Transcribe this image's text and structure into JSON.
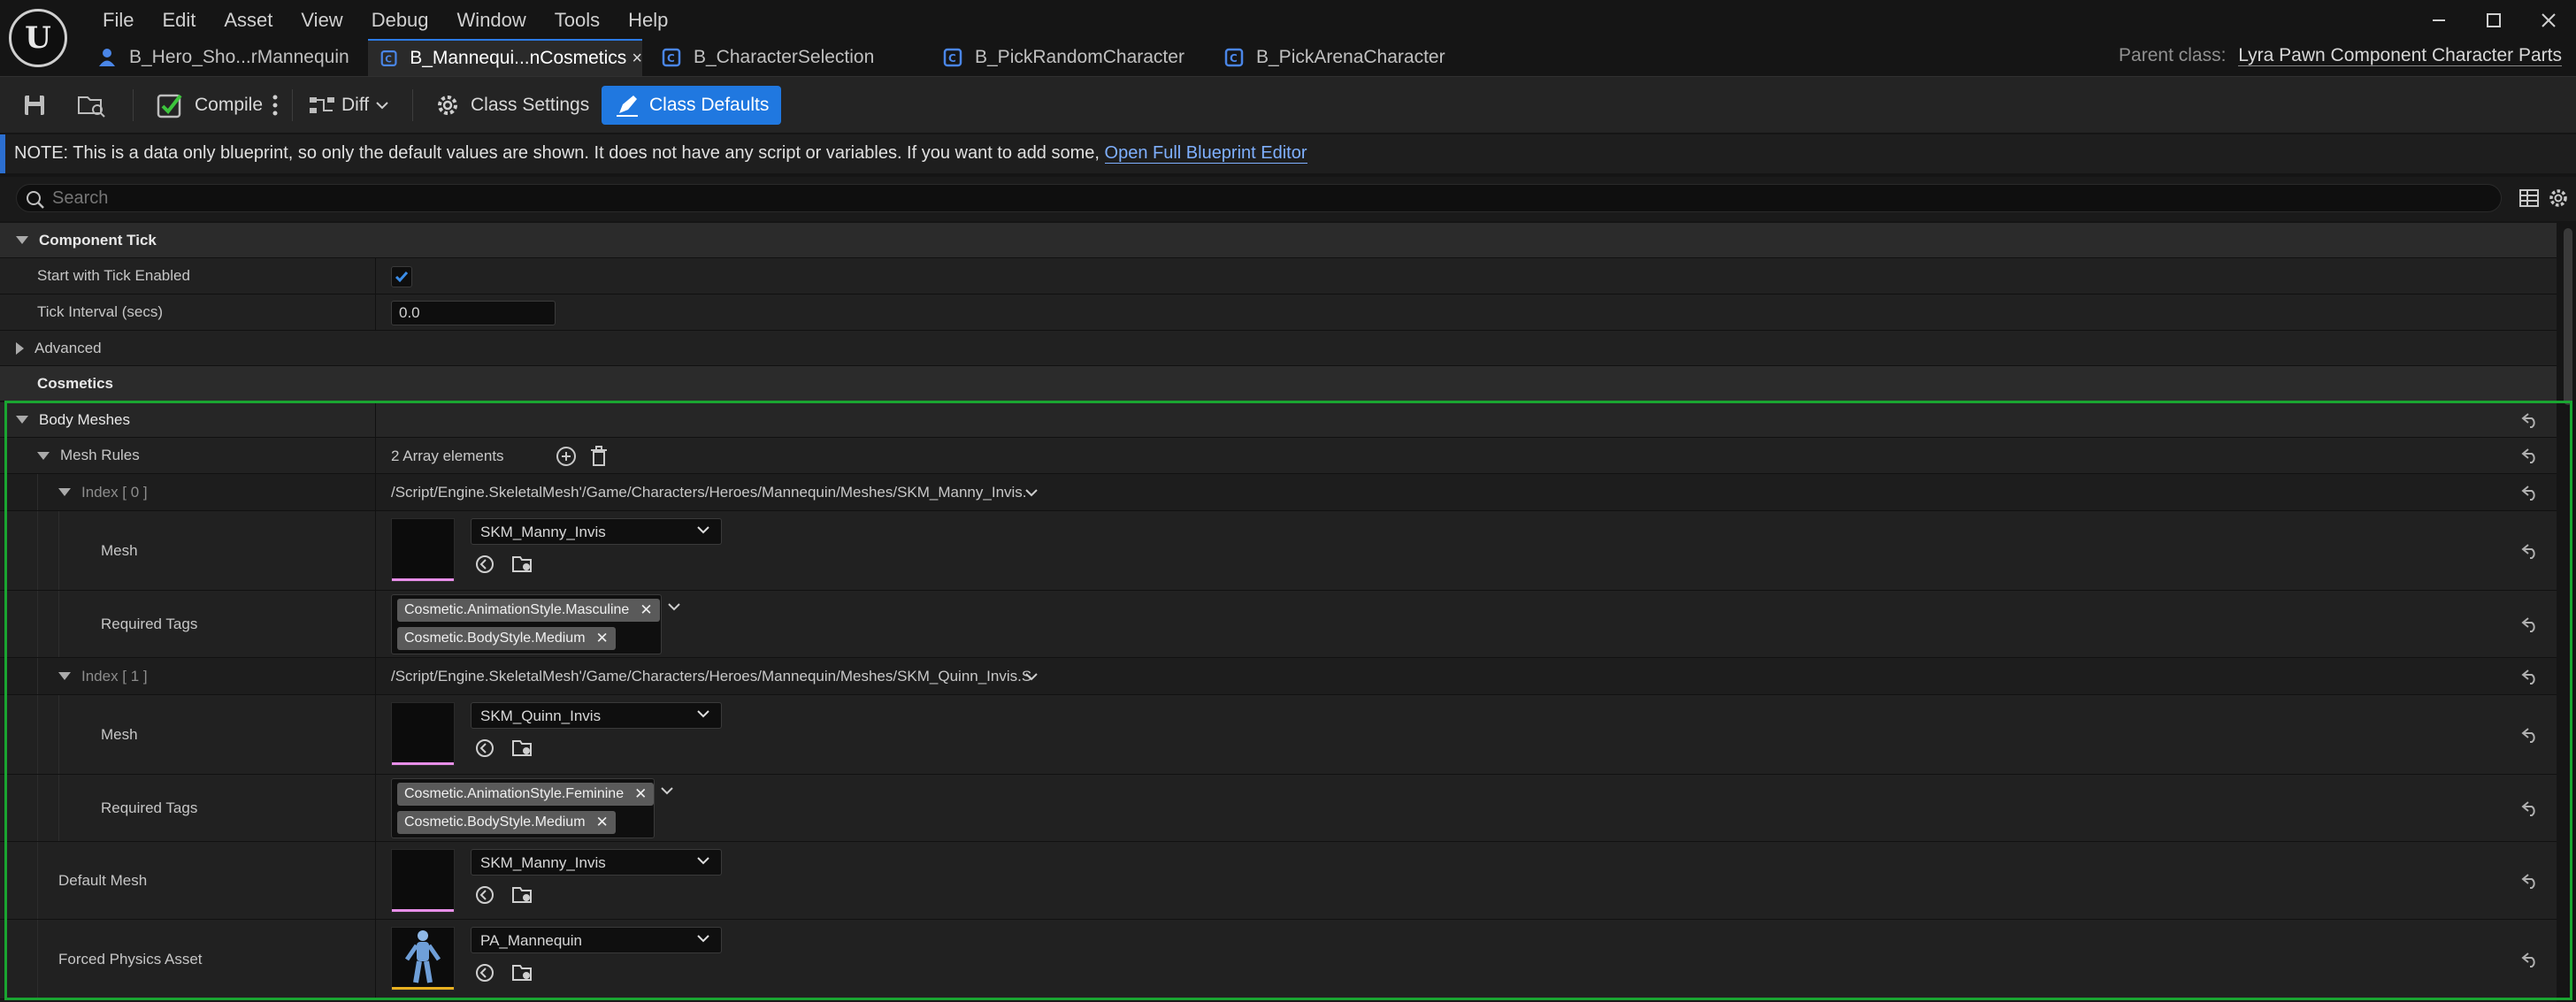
{
  "app": {
    "logo_letter": "U"
  },
  "menu": [
    "File",
    "Edit",
    "Asset",
    "View",
    "Debug",
    "Window",
    "Tools",
    "Help"
  ],
  "tabs": [
    {
      "label": "B_Hero_Sho...rMannequin",
      "icon": "pawn-icon"
    },
    {
      "label": "B_Mannequi...nCosmetics",
      "icon": "blueprint-icon",
      "active": true
    },
    {
      "label": "B_CharacterSelection",
      "icon": "blueprint-icon"
    },
    {
      "label": "B_PickRandomCharacter",
      "icon": "blueprint-icon"
    },
    {
      "label": "B_PickArenaCharacter",
      "icon": "blueprint-icon"
    }
  ],
  "parent_class": {
    "label": "Parent class:",
    "value": "Lyra Pawn Component Character Parts"
  },
  "toolbar": {
    "compile": "Compile",
    "diff": "Diff",
    "class_settings": "Class Settings",
    "class_defaults": "Class Defaults"
  },
  "note": {
    "text": "NOTE: This is a data only blueprint, so only the default values are shown.  It does not have any script or variables.  If you want to add some, ",
    "link": "Open Full Blueprint Editor"
  },
  "search": {
    "placeholder": "Search"
  },
  "details": {
    "component_tick": {
      "title": "Component Tick",
      "start_with_tick": {
        "label": "Start with Tick Enabled",
        "checked": true
      },
      "tick_interval": {
        "label": "Tick Interval (secs)",
        "value": "0.0"
      },
      "advanced": "Advanced"
    },
    "cosmetics": {
      "title": "Cosmetics",
      "body_meshes": "Body Meshes",
      "mesh_rules": {
        "label": "Mesh Rules",
        "count": "2 Array elements"
      },
      "index0": {
        "label": "Index [ 0 ]",
        "path": "/Script/Engine.SkeletalMesh'/Game/Characters/Heroes/Mannequin/Meshes/SKM_Manny_Invis.",
        "mesh_label": "Mesh",
        "mesh_value": "SKM_Manny_Invis",
        "tags_label": "Required Tags",
        "tags": [
          "Cosmetic.AnimationStyle.Masculine",
          "Cosmetic.BodyStyle.Medium"
        ]
      },
      "index1": {
        "label": "Index [ 1 ]",
        "path": "/Script/Engine.SkeletalMesh'/Game/Characters/Heroes/Mannequin/Meshes/SKM_Quinn_Invis.S",
        "mesh_label": "Mesh",
        "mesh_value": "SKM_Quinn_Invis",
        "tags_label": "Required Tags",
        "tags": [
          "Cosmetic.AnimationStyle.Feminine",
          "Cosmetic.BodyStyle.Medium"
        ]
      },
      "default_mesh": {
        "label": "Default Mesh",
        "value": "SKM_Manny_Invis"
      },
      "forced_physics": {
        "label": "Forced Physics Asset",
        "value": "PA_Mannequin"
      }
    }
  },
  "colors": {
    "accent": "#2078e0",
    "selection": "#1aa531",
    "mesh_bar": "#e78ee8",
    "physics_bar": "#e8b020"
  }
}
